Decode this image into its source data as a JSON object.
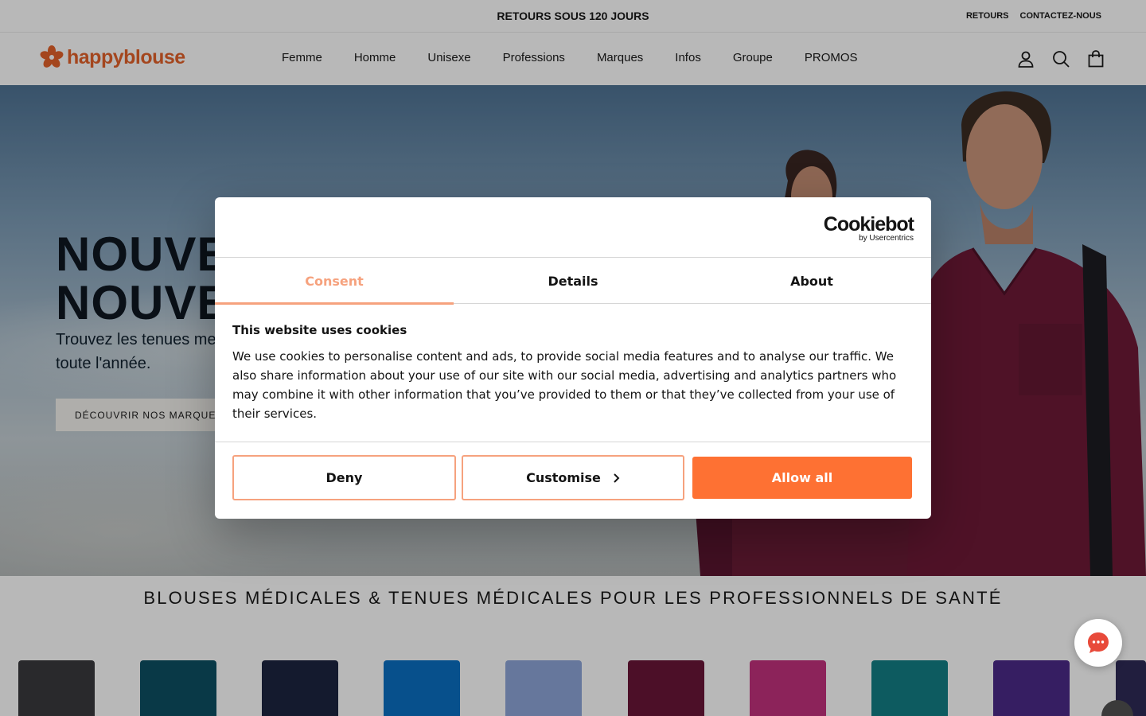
{
  "announcement": {
    "text": "RETOURS SOUS 120 JOURS"
  },
  "utility_links": {
    "returns": "RETOURS",
    "contact": "CONTACTEZ-NOUS"
  },
  "header": {
    "logo_text": "happyblouse",
    "nav": [
      "Femme",
      "Homme",
      "Unisexe",
      "Professions",
      "Marques",
      "Infos",
      "Groupe",
      "PROMOS"
    ],
    "icons": [
      "account-icon",
      "search-icon",
      "cart-icon"
    ]
  },
  "hero": {
    "title": "NOUVE\nNOUVE",
    "subtitle": "Trouvez les tenues me\ntoute l'année.",
    "cta": "DÉCOUVRIR NOS MARQUES"
  },
  "section": {
    "title": "BLOUSES MÉDICALES & TENUES MÉDICALES POUR LES PROFESSIONNELS DE SANTÉ"
  },
  "products": {
    "swatches": [
      "#3a3a3d",
      "#0d4f63",
      "#1d2440",
      "#0a6fc2",
      "#8ea6d8",
      "#6a1538",
      "#c2317d",
      "#127f86",
      "#4c2a88",
      "#2f2a56"
    ]
  },
  "cookie_dialog": {
    "brand": "Cookiebot",
    "brand_sub": "by Usercentrics",
    "tabs": [
      "Consent",
      "Details",
      "About"
    ],
    "active_tab": "Consent",
    "heading": "This website uses cookies",
    "body": "We use cookies to personalise content and ads, to provide social media features and to analyse our traffic. We also share information about your use of our site with our social media, advertising and analytics partners who may combine it with other information that you’ve provided to them or that they’ve collected from your use of their services.",
    "buttons": {
      "deny": "Deny",
      "customise": "Customise",
      "allow": "Allow all"
    },
    "accent_color": "#fe7133",
    "tab_accent_color": "#f6a27e"
  },
  "chat": {
    "icon": "chat-icon"
  }
}
